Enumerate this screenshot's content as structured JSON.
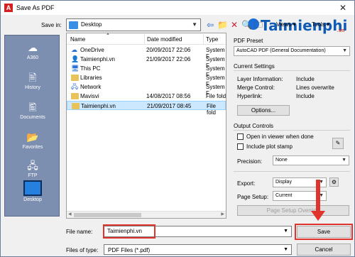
{
  "window": {
    "title": "Save As PDF",
    "app_icon_label": "A",
    "close_glyph": "✕"
  },
  "toolbar": {
    "save_in_label": "Save in:",
    "save_in_value": "Desktop",
    "views_label": "Views",
    "tools_label": "Tools",
    "icons": [
      "back-icon",
      "up-folder-icon",
      "delete-icon",
      "search-web-icon",
      "new-folder-icon"
    ]
  },
  "places": [
    {
      "label": "A360",
      "icon": "cloud-icon"
    },
    {
      "label": "History",
      "icon": "history-icon"
    },
    {
      "label": "Documents",
      "icon": "documents-icon"
    },
    {
      "label": "Favorites",
      "icon": "favorites-icon"
    },
    {
      "label": "FTP",
      "icon": "ftp-icon"
    },
    {
      "label": "Desktop",
      "icon": "desktop-icon"
    }
  ],
  "file_list": {
    "columns": [
      "Name",
      "Date modified",
      "Type"
    ],
    "rows": [
      {
        "name": "OneDrive",
        "date": "20/09/2017 22:06",
        "type": "System F"
      },
      {
        "name": "Taimienphi.vn",
        "date": "21/09/2017 22:06",
        "type": "System F"
      },
      {
        "name": "This PC",
        "date": "",
        "type": "System F"
      },
      {
        "name": "Libraries",
        "date": "",
        "type": "System F"
      },
      {
        "name": "Network",
        "date": "",
        "type": "System F"
      },
      {
        "name": "Mavisvi",
        "date": "14/08/2017 08:56",
        "type": "File fold"
      },
      {
        "name": "Taimienphi.vn",
        "date": "21/09/2017 08:45",
        "type": "File fold"
      }
    ]
  },
  "pdf_preset": {
    "label": "PDF Preset",
    "value": "AutoCAD PDF (General Documentation)"
  },
  "current_settings": {
    "title": "Current Settings",
    "layer_label": "Layer Information:",
    "layer_value": "Include",
    "merge_label": "Merge Control:",
    "merge_value": "Lines overwrite",
    "hyperlink_label": "Hyperlink:",
    "hyperlink_value": "Include",
    "options_button": "Options..."
  },
  "output_controls": {
    "title": "Output Controls",
    "open_viewer_label": "Open in viewer when done",
    "plot_stamp_label": "Include plot stamp",
    "precision_label": "Precision:",
    "precision_value": "None"
  },
  "export": {
    "export_label": "Export:",
    "export_value": "Display",
    "page_setup_label": "Page Setup:",
    "page_setup_value": "Current",
    "page_setup_override_button": "Page Setup Override"
  },
  "bottom": {
    "file_name_label": "File name:",
    "file_name_value": "Taimienphi.vn",
    "files_of_type_label": "Files of type:",
    "files_of_type_value": "PDF Files (*.pdf)",
    "save_button": "Save",
    "cancel_button": "Cancel"
  },
  "watermark": {
    "text": "Taimienphi",
    "suffix": ".vn"
  },
  "colors": {
    "annotation_red": "#e0332b",
    "selection": "#cce8ff",
    "places_bg": "#7d8fb0"
  }
}
